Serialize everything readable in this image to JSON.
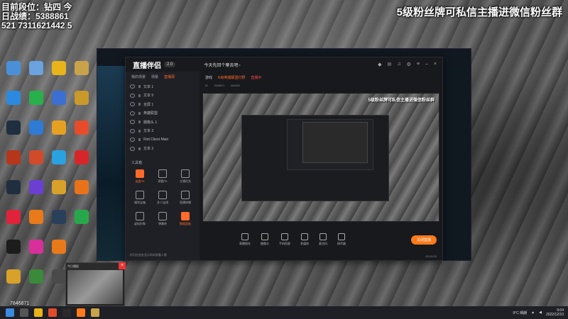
{
  "overlay": {
    "stats": "目前段位：钻四 今日战绩：5388861521 7311621442 5",
    "banner": "5级粉丝牌可私信主播进微信粉丝群"
  },
  "streaming_app": {
    "logo": "直播伴侣",
    "version": "2.0",
    "title": "今天先回个寨去吧~",
    "left_tabs": [
      "我的场景",
      "场景",
      "直播源"
    ],
    "scenes": [
      "文本 1",
      "文本 5",
      "全屏 1",
      "英雄联盟",
      "摄像头 1",
      "文本 3",
      "Riot Client Main",
      "文本 2"
    ],
    "tools_title": "工具箱",
    "tools": [
      {
        "label": "连麦PK",
        "hot": true
      },
      {
        "label": "观看PK",
        "hot": false
      },
      {
        "label": "主播任务",
        "hot": false
      },
      {
        "label": "福利宝箱",
        "hot": false
      },
      {
        "label": "多人连线",
        "hot": false
      },
      {
        "label": "直播转播",
        "hot": false
      },
      {
        "label": "虚拟形象",
        "hot": false
      },
      {
        "label": "弹幕库",
        "hot": false
      },
      {
        "label": "数据面板",
        "hot": true
      }
    ],
    "tip": "你可在此处显示你的观看人数",
    "top_bar": {
      "tag": "游戏",
      "category": "K级英雄联盟打野",
      "live_badge": "直播中",
      "id_label": "ID",
      "id_value": "7846871",
      "viewers": "404482"
    },
    "preview_text": "5级粉丝牌可私信主播进微信粉丝群",
    "bottom_tools": [
      "直播保存",
      "摄像头",
      "手机投屏",
      "多媒体",
      "麦克风",
      "扬声器"
    ],
    "start_button": "关闭直播",
    "status": "00:00:00"
  },
  "popup": {
    "header": "今日播报",
    "close": "×"
  },
  "bottom_left": {
    "id": "7846871"
  },
  "taskbar": {
    "weather": "9°C 晴朗",
    "time": "9:04",
    "date": "2022/12/10"
  },
  "colors": {
    "accent": "#ff7a1a",
    "app_bg": "#1c1d22"
  }
}
